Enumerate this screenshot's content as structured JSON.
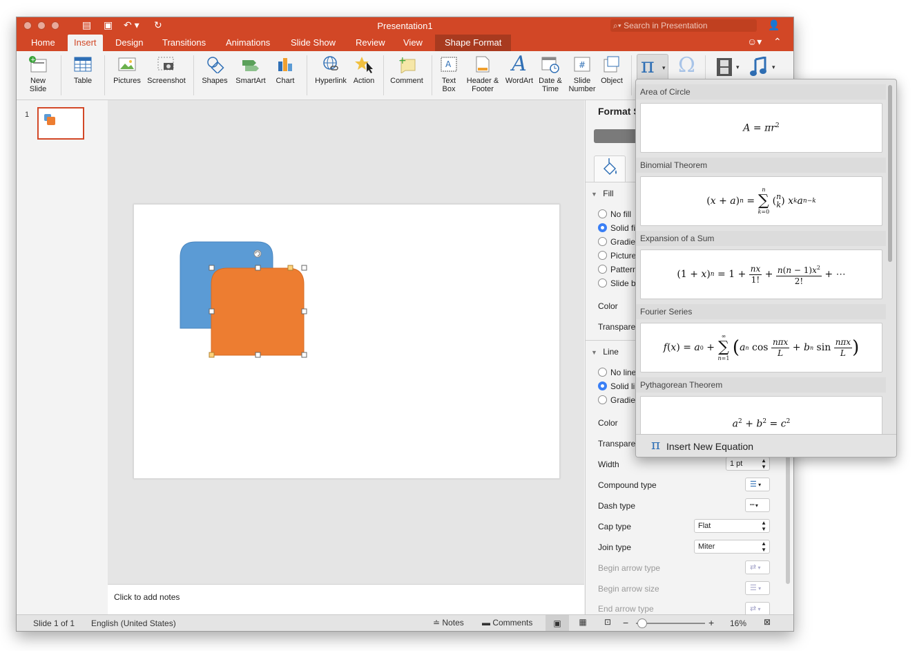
{
  "window": {
    "title": "Presentation1",
    "search_placeholder": "Search in Presentation"
  },
  "tabs": [
    {
      "label": "Home"
    },
    {
      "label": "Insert"
    },
    {
      "label": "Design"
    },
    {
      "label": "Transitions"
    },
    {
      "label": "Animations"
    },
    {
      "label": "Slide Show"
    },
    {
      "label": "Review"
    },
    {
      "label": "View"
    },
    {
      "label": "Shape Format"
    }
  ],
  "ribbon": {
    "new_slide_1": "New",
    "new_slide_2": "Slide",
    "table": "Table",
    "pictures": "Pictures",
    "screenshot": "Screenshot",
    "shapes": "Shapes",
    "smartart": "SmartArt",
    "chart": "Chart",
    "hyperlink": "Hyperlink",
    "action": "Action",
    "comment": "Comment",
    "textbox_1": "Text",
    "textbox_2": "Box",
    "headerfooter_1": "Header &",
    "headerfooter_2": "Footer",
    "wordart": "WordArt",
    "datetime_1": "Date &",
    "datetime_2": "Time",
    "slidenumber_1": "Slide",
    "slidenumber_2": "Number",
    "object": "Object",
    "equation_glyph": "π",
    "symbol_glyph": "Ω"
  },
  "thumbnails": {
    "slide_number": "1"
  },
  "notes": {
    "placeholder": "Click to add notes"
  },
  "format_pane": {
    "title": "Format S",
    "fill_section": "Fill",
    "fill_options": [
      "No fill",
      "Solid fil",
      "Gradier",
      "Picture",
      "Pattern",
      "Slide ba"
    ],
    "color": "Color",
    "transparency": "Transparen",
    "line_section": "Line",
    "line_options": [
      "No line",
      "Solid li",
      "Gradier"
    ],
    "line_color": "Color",
    "line_transparency": "Transparen",
    "width_label": "Width",
    "width_value": "1 pt",
    "compound_label": "Compound type",
    "dash_label": "Dash type",
    "cap_label": "Cap type",
    "cap_value": "Flat",
    "join_label": "Join type",
    "join_value": "Miter",
    "begin_arrow_type": "Begin arrow type",
    "begin_arrow_size": "Begin arrow size",
    "end_arrow_type": "End arrow type"
  },
  "statusbar": {
    "slide_info": "Slide 1 of 1",
    "language": "English (United States)",
    "notes": "Notes",
    "comments": "Comments",
    "zoom_minus": "−",
    "zoom_plus": "+",
    "zoom": "16%"
  },
  "equations": {
    "items": [
      {
        "title": "Area of Circle"
      },
      {
        "title": "Binomial Theorem"
      },
      {
        "title": "Expansion of a Sum"
      },
      {
        "title": "Fourier Series"
      },
      {
        "title": "Pythagorean Theorem"
      }
    ],
    "insert_new": "Insert New Equation"
  },
  "colors": {
    "accent": "#d24726",
    "shape_blue": "#5b9bd5",
    "shape_orange": "#ed7d31",
    "selection_blue": "#3a7ff5"
  }
}
